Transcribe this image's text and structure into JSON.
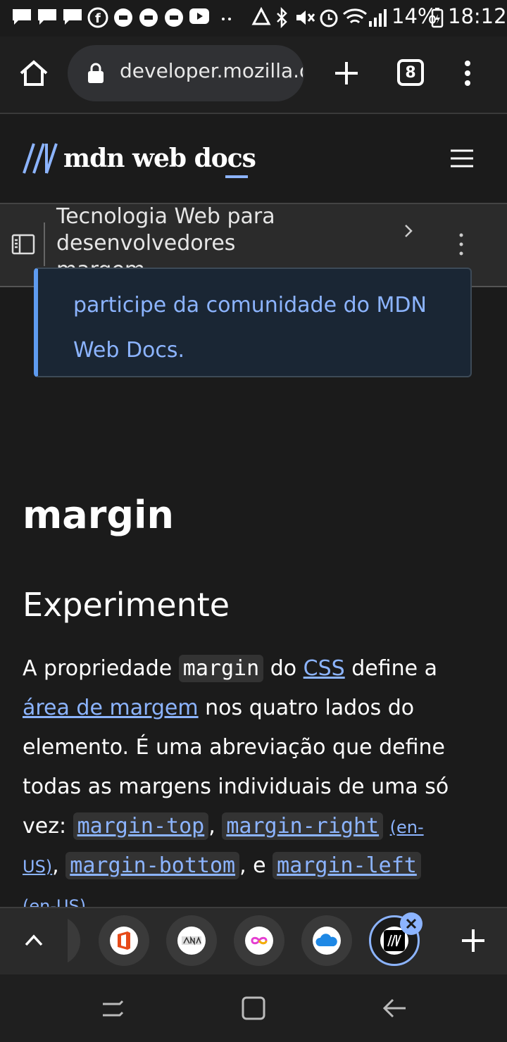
{
  "status_bar": {
    "battery": "14%",
    "time": "18:12"
  },
  "browser": {
    "url": "developer.mozilla.org",
    "tab_count": "8"
  },
  "mdn": {
    "logo_text": "mdn web docs"
  },
  "breadcrumb": {
    "line1": "Tecnologia Web para",
    "line2": "desenvolvedores",
    "line3": "margem"
  },
  "callout": {
    "line1": "participe da comunidade do MDN",
    "line2": "Web Docs."
  },
  "article": {
    "title": "margin",
    "section": "Experimente",
    "p_a_propriedade": "A propriedade",
    "code_margin": "margin",
    "p_do": "do",
    "link_css": "CSS",
    "p_define_a": "define a",
    "link_area": "área de margem",
    "p_nos_quatro": "nos quatro lados do",
    "p_line3": "elemento. É uma abreviação que define",
    "p_line4": "todas as margens individuais de uma só",
    "p_vez": "vez:",
    "code_margin_top": "margin-top",
    "code_margin_right": "margin-right",
    "en_us_1a": "(en-",
    "en_us_1b": "US)",
    "code_margin_bottom": "margin-bottom",
    "p_e": ", e",
    "code_margin_left": "margin-left",
    "en_us_2": "(en-US)"
  },
  "colors": {
    "accent_link": "#8cb4ff",
    "callout_border": "#5e9bf0",
    "background": "#1b1b1b"
  }
}
